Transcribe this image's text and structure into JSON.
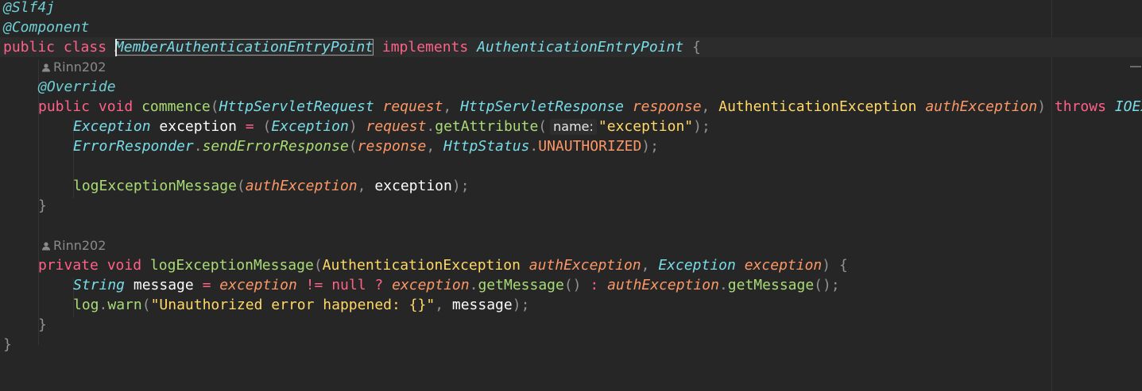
{
  "editor": {
    "lines": [
      {
        "tokens": [
          {
            "t": "@Slf4j",
            "c": "ann"
          }
        ]
      },
      {
        "tokens": [
          {
            "t": "@Component",
            "c": "ann"
          }
        ]
      },
      {
        "current": true,
        "tokens": [
          {
            "t": "public",
            "c": "kw"
          },
          {
            "t": " "
          },
          {
            "t": "class",
            "c": "kw"
          },
          {
            "t": " "
          },
          {
            "t": "MemberAuthenticationEntryPoint",
            "c": "type sel-word",
            "name": "class-name-selected"
          },
          {
            "t": " "
          },
          {
            "t": "implements",
            "c": "kw"
          },
          {
            "t": " "
          },
          {
            "t": "AuthenticationEntryPoint",
            "c": "type"
          },
          {
            "t": " "
          },
          {
            "t": "{",
            "c": "punc"
          }
        ]
      },
      {
        "hint": "Rinn202"
      },
      {
        "indent": 1,
        "tokens": [
          {
            "t": "@Override",
            "c": "ann"
          }
        ]
      },
      {
        "indent": 1,
        "tokens": [
          {
            "t": "public",
            "c": "kw"
          },
          {
            "t": " "
          },
          {
            "t": "void",
            "c": "kw"
          },
          {
            "t": " "
          },
          {
            "t": "commence",
            "c": "fn"
          },
          {
            "t": "(",
            "c": "punc"
          },
          {
            "t": "HttpServletRequest",
            "c": "type"
          },
          {
            "t": " "
          },
          {
            "t": "request",
            "c": "param"
          },
          {
            "t": ", ",
            "c": "punc"
          },
          {
            "t": "HttpServletResponse",
            "c": "type"
          },
          {
            "t": " "
          },
          {
            "t": "response",
            "c": "param"
          },
          {
            "t": ", ",
            "c": "punc"
          },
          {
            "t": "AuthenticationException",
            "c": "str"
          },
          {
            "t": " "
          },
          {
            "t": "authException",
            "c": "param"
          },
          {
            "t": ") ",
            "c": "punc"
          },
          {
            "t": "throws",
            "c": "kw"
          },
          {
            "t": " "
          },
          {
            "t": "IOException",
            "c": "type"
          }
        ]
      },
      {
        "indent": 2,
        "tokens": [
          {
            "t": "Exception",
            "c": "type"
          },
          {
            "t": " "
          },
          {
            "t": "exception",
            "c": "plain"
          },
          {
            "t": " "
          },
          {
            "t": "=",
            "c": "kw"
          },
          {
            "t": " "
          },
          {
            "t": "(",
            "c": "punc"
          },
          {
            "t": "Exception",
            "c": "type"
          },
          {
            "t": ")",
            "c": "punc"
          },
          {
            "t": " "
          },
          {
            "t": "request",
            "c": "param"
          },
          {
            "t": ".",
            "c": "punc"
          },
          {
            "t": "getAttribute",
            "c": "fn"
          },
          {
            "t": "(",
            "c": "punc"
          },
          {
            "hint": "name:"
          },
          {
            "t": "\"exception\"",
            "c": "str"
          },
          {
            "t": ");",
            "c": "punc"
          }
        ]
      },
      {
        "indent": 2,
        "tokens": [
          {
            "t": "ErrorResponder",
            "c": "type"
          },
          {
            "t": ".",
            "c": "punc"
          },
          {
            "t": "sendErrorResponse",
            "c": "fnit"
          },
          {
            "t": "(",
            "c": "punc"
          },
          {
            "t": "response",
            "c": "param"
          },
          {
            "t": ", ",
            "c": "punc"
          },
          {
            "t": "HttpStatus",
            "c": "type"
          },
          {
            "t": ".",
            "c": "punc"
          },
          {
            "t": "UNAUTHORIZED",
            "c": "const"
          },
          {
            "t": ");",
            "c": "punc"
          }
        ]
      },
      {
        "tokens": []
      },
      {
        "indent": 2,
        "tokens": [
          {
            "t": "logExceptionMessage",
            "c": "fn"
          },
          {
            "t": "(",
            "c": "punc"
          },
          {
            "t": "authException",
            "c": "param"
          },
          {
            "t": ", ",
            "c": "punc"
          },
          {
            "t": "exception",
            "c": "plain"
          },
          {
            "t": ");",
            "c": "punc"
          }
        ]
      },
      {
        "indent": 1,
        "tokens": [
          {
            "t": "}",
            "c": "punc"
          }
        ]
      },
      {
        "tokens": []
      },
      {
        "hint": "Rinn202"
      },
      {
        "indent": 1,
        "tokens": [
          {
            "t": "private",
            "c": "kw"
          },
          {
            "t": " "
          },
          {
            "t": "void",
            "c": "kw"
          },
          {
            "t": " "
          },
          {
            "t": "logExceptionMessage",
            "c": "fn"
          },
          {
            "t": "(",
            "c": "punc"
          },
          {
            "t": "AuthenticationException",
            "c": "str"
          },
          {
            "t": " "
          },
          {
            "t": "authException",
            "c": "param"
          },
          {
            "t": ", ",
            "c": "punc"
          },
          {
            "t": "Exception",
            "c": "type"
          },
          {
            "t": " "
          },
          {
            "t": "exception",
            "c": "param"
          },
          {
            "t": ") ",
            "c": "punc"
          },
          {
            "t": "{",
            "c": "punc"
          }
        ]
      },
      {
        "indent": 2,
        "tokens": [
          {
            "t": "String",
            "c": "type"
          },
          {
            "t": " "
          },
          {
            "t": "message",
            "c": "plain"
          },
          {
            "t": " "
          },
          {
            "t": "=",
            "c": "kw"
          },
          {
            "t": " "
          },
          {
            "t": "exception",
            "c": "param"
          },
          {
            "t": " "
          },
          {
            "t": "!=",
            "c": "kw"
          },
          {
            "t": " "
          },
          {
            "t": "null",
            "c": "kw"
          },
          {
            "t": " "
          },
          {
            "t": "?",
            "c": "kw"
          },
          {
            "t": " "
          },
          {
            "t": "exception",
            "c": "param"
          },
          {
            "t": ".",
            "c": "punc"
          },
          {
            "t": "getMessage",
            "c": "fn"
          },
          {
            "t": "()",
            "c": "punc"
          },
          {
            "t": " "
          },
          {
            "t": ":",
            "c": "kw"
          },
          {
            "t": " "
          },
          {
            "t": "authException",
            "c": "param"
          },
          {
            "t": ".",
            "c": "punc"
          },
          {
            "t": "getMessage",
            "c": "fn"
          },
          {
            "t": "();",
            "c": "punc"
          }
        ]
      },
      {
        "indent": 2,
        "tokens": [
          {
            "t": "log",
            "c": "fn"
          },
          {
            "t": ".",
            "c": "punc"
          },
          {
            "t": "warn",
            "c": "fn"
          },
          {
            "t": "(",
            "c": "punc"
          },
          {
            "t": "\"Unauthorized error happened: {}\"",
            "c": "str"
          },
          {
            "t": ", ",
            "c": "punc"
          },
          {
            "t": "message",
            "c": "plain"
          },
          {
            "t": ");",
            "c": "punc"
          }
        ]
      },
      {
        "indent": 1,
        "tokens": [
          {
            "t": "}",
            "c": "punc"
          }
        ]
      },
      {
        "tokens": [
          {
            "t": "}",
            "c": "punc"
          }
        ]
      }
    ]
  }
}
